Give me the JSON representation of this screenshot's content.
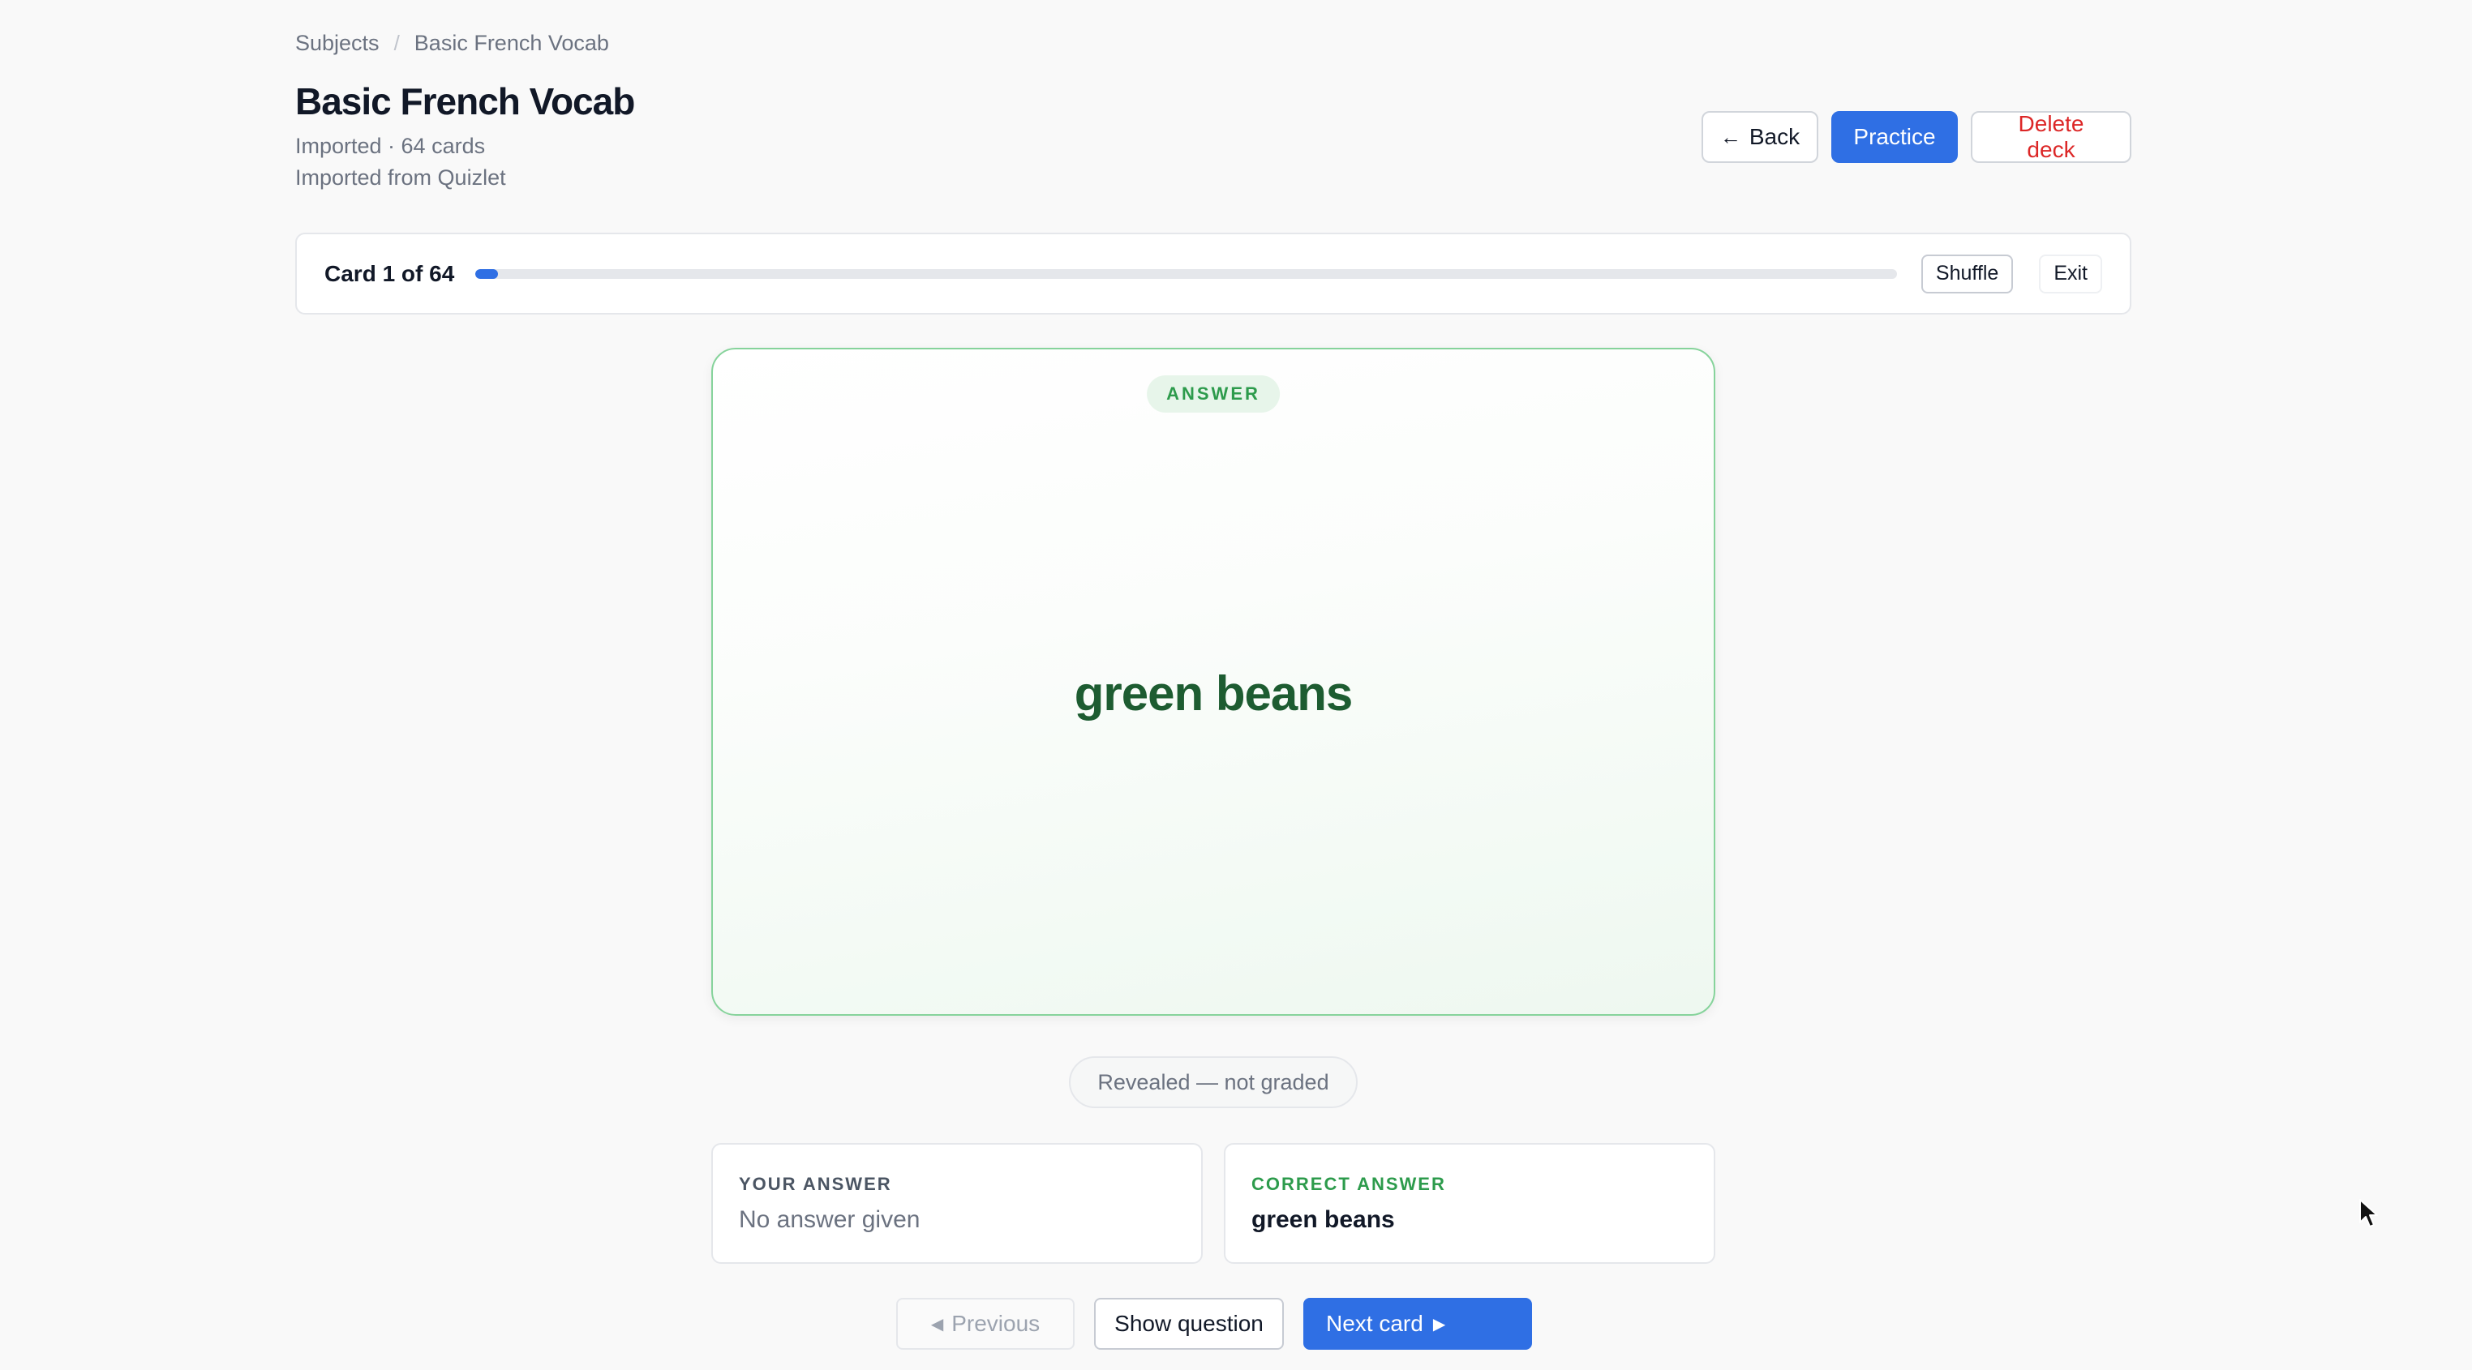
{
  "breadcrumb": {
    "items": [
      "Subjects",
      "Basic French Vocab"
    ],
    "separator": "/"
  },
  "deck": {
    "title": "Basic French Vocab",
    "meta": "Imported · 64 cards",
    "source": "Imported from Quizlet"
  },
  "header_actions": {
    "back_icon": "arrow-left-icon",
    "back_label": "Back",
    "practice_label": "Practice",
    "delete_label": "Delete deck"
  },
  "progress": {
    "label": "Card 1 of 64",
    "current": 1,
    "total": 64,
    "shuffle_label": "Shuffle",
    "exit_label": "Exit"
  },
  "card": {
    "side_label": "ANSWER",
    "text": "green beans"
  },
  "status": {
    "label": "Revealed — not graded"
  },
  "your_answer": {
    "label": "YOUR ANSWER",
    "value": "No answer given"
  },
  "correct_answer": {
    "label": "CORRECT ANSWER",
    "value": "green beans"
  },
  "nav": {
    "previous_label": "Previous",
    "show_question_label": "Show question",
    "next_label": "Next card"
  },
  "colors": {
    "primary": "#2f6fe4",
    "danger": "#dc2626",
    "success": "#2d9b4c",
    "card_text": "#1d5c31"
  }
}
